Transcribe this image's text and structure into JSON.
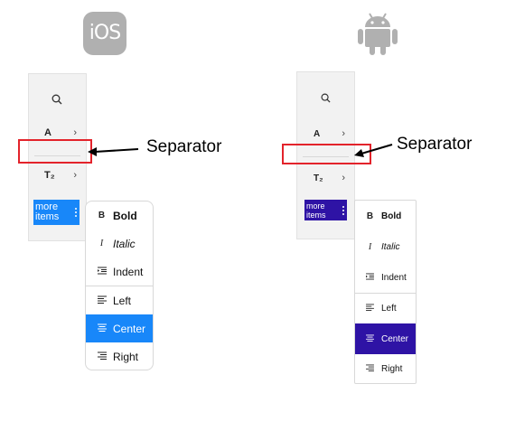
{
  "ios": {
    "logo_text": "iOS",
    "toolbar": {
      "search_icon": "search-icon",
      "font_size_icon": "A",
      "text_style_icon": "T₂",
      "more_label_line1": "more",
      "more_label_line2": "items"
    },
    "menu": {
      "items": [
        {
          "icon": "B",
          "label": "Bold"
        },
        {
          "icon": "I",
          "label": "Italic"
        },
        {
          "icon": "indent-icon",
          "label": "Indent"
        },
        {
          "icon": "align-left-icon",
          "label": "Left"
        },
        {
          "icon": "align-center-icon",
          "label": "Center"
        },
        {
          "icon": "align-right-icon",
          "label": "Right"
        }
      ],
      "selected": "Center"
    },
    "callout": "Separator",
    "accent": "#1887f9"
  },
  "android": {
    "logo": "android-icon",
    "toolbar": {
      "search_icon": "search-icon",
      "font_size_icon": "A",
      "text_style_icon": "T₂",
      "more_label_line1": "more",
      "more_label_line2": "items"
    },
    "menu": {
      "items": [
        {
          "icon": "B",
          "label": "Bold"
        },
        {
          "icon": "I",
          "label": "Italic"
        },
        {
          "icon": "indent-icon",
          "label": "Indent"
        },
        {
          "icon": "align-left-icon",
          "label": "Left"
        },
        {
          "icon": "align-center-icon",
          "label": "Center"
        },
        {
          "icon": "align-right-icon",
          "label": "Right"
        }
      ],
      "selected": "Center"
    },
    "callout": "Separator",
    "accent": "#2e13a5"
  },
  "colors": {
    "callout_border": "#e3232b",
    "logo_gray": "#b0b0b0"
  }
}
